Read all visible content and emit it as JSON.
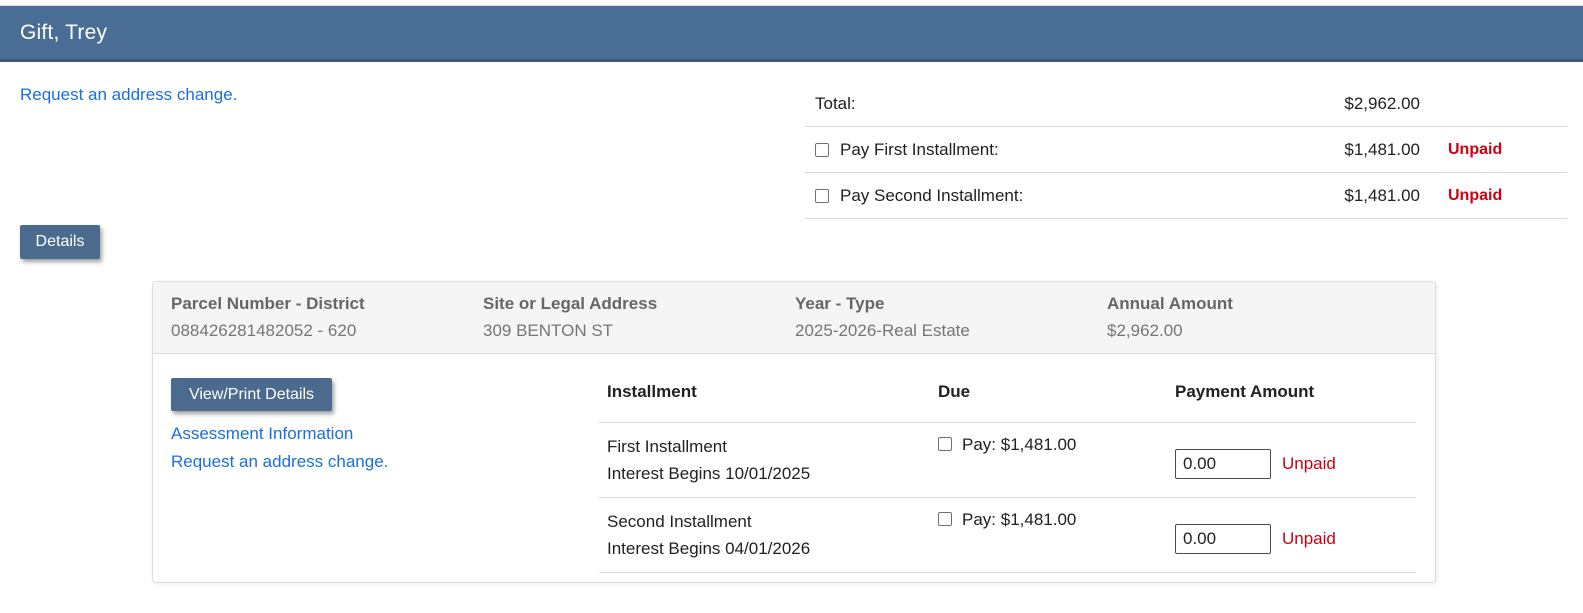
{
  "header": {
    "title": "Gift, Trey"
  },
  "top_link": {
    "label": "Request an address change."
  },
  "summary": {
    "total_label": "Total:",
    "total_amount": "$2,962.00",
    "installments": [
      {
        "label": "Pay First Installment:",
        "amount": "$1,481.00",
        "status": "Unpaid"
      },
      {
        "label": "Pay Second Installment:",
        "amount": "$1,481.00",
        "status": "Unpaid"
      }
    ]
  },
  "details_button_label": "Details",
  "panel": {
    "header_fields": [
      {
        "label": "Parcel Number - District",
        "value": "088426281482052 - 620"
      },
      {
        "label": "Site or Legal Address",
        "value": "309 BENTON ST"
      },
      {
        "label": "Year - Type",
        "value": "2025-2026-Real Estate"
      },
      {
        "label": "Annual Amount",
        "value": "$2,962.00"
      }
    ],
    "actions": {
      "view_print_label": "View/Print Details",
      "assessment_link": "Assessment Information",
      "address_change_link": "Request an address change."
    },
    "table": {
      "columns": {
        "installment": "Installment",
        "due": "Due",
        "payment": "Payment Amount"
      },
      "rows": [
        {
          "name": "First Installment",
          "interest": "Interest Begins 10/01/2025",
          "due": "Pay: $1,481.00",
          "payment_value": "0.00",
          "status": "Unpaid"
        },
        {
          "name": "Second Installment",
          "interest": "Interest Begins 04/01/2026",
          "due": "Pay: $1,481.00",
          "payment_value": "0.00",
          "status": "Unpaid"
        }
      ]
    }
  },
  "colors": {
    "topbar_blue": "#4a6d96",
    "button_blue": "#4a6b8e",
    "link_blue": "#1a6fe0",
    "unpaid_red": "#cc0011",
    "panel_header_bg": "#f5f5f5",
    "panel_text_gray": "#757575"
  }
}
